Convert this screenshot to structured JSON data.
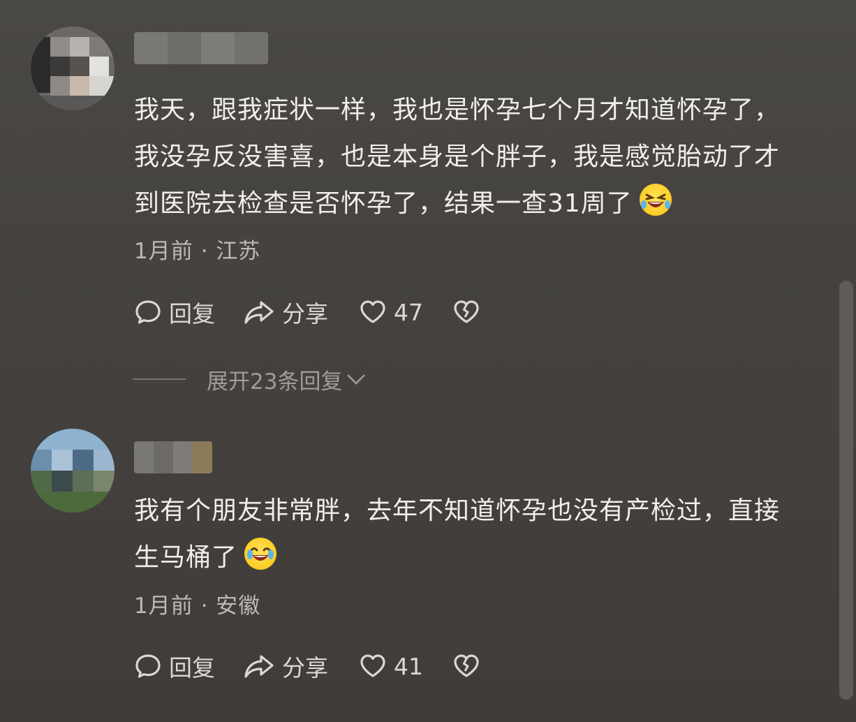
{
  "comments": [
    {
      "text_lines": [
        "我天，跟我症状一样，我也是怀孕七个月才知道怀孕了，",
        "我没孕反没害喜，也是本身是个胖子，我是感觉胎动了才",
        "到医院去检查是否怀孕了，结果一查31周了"
      ],
      "emoji": "rolling-laughing-emoji",
      "meta": "1月前 · 江苏",
      "reply_label": "回复",
      "share_label": "分享",
      "like_count": "47"
    },
    {
      "text_lines": [
        "我有个朋友非常胖，去年不知道怀孕也没有产检过，直接",
        "生马桶了"
      ],
      "emoji": "tears-of-joy-emoji",
      "meta": "1月前 · 安徽",
      "reply_label": "回复",
      "share_label": "分享",
      "like_count": "41"
    }
  ],
  "expand_replies": "展开23条回复",
  "colors": {
    "background": "#46433f",
    "text": "#f1efec",
    "meta": "#bdbab6",
    "muted": "#9f9c98"
  }
}
